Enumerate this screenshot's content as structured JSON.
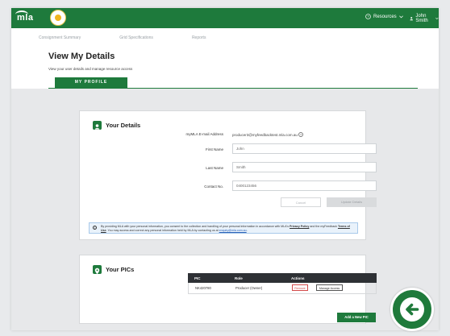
{
  "brand": {
    "logo_text": "mla"
  },
  "header": {
    "resources_label": "Resources",
    "user_label": "John Smith"
  },
  "nav": {
    "tabs": [
      "Consignment Summary",
      "Grid Specifications",
      "Reports"
    ]
  },
  "page": {
    "title": "View My Details",
    "subtitle": "View your user details and manage resource access",
    "profile_tab": "MY PROFILE"
  },
  "details": {
    "section_title": "Your Details",
    "email_label": "myMLA E-mail Address",
    "email_value": "producer3@myfeedbacktest.mla.com.au",
    "first_name_label": "First Name",
    "first_name_value": "John",
    "last_name_label": "Last Name",
    "last_name_value": "Smith",
    "contact_label": "Contact No.",
    "contact_value": "0400123456",
    "cancel_label": "Cancel",
    "update_label": "Update Details"
  },
  "notice": {
    "text_1": "By providing MLA with your personal information, you consent to the collection and handling of your personal information in accordance with MLA's",
    "privacy_link": "Privacy Policy",
    "text_2": "and the",
    "text_3": "myFeedback",
    "terms_link": "Terms of Use",
    "text_4": ". You may access and correct any personal information held by MLA by contacting us at",
    "email_link": "enquiry@mla.com.au",
    "text_5": "."
  },
  "pics": {
    "section_title": "Your PICs",
    "headers": {
      "pic": "PIC",
      "role": "Role",
      "actions": "Actions"
    },
    "rows": [
      {
        "pic": "NK420780",
        "role": "Producer (Owner)",
        "remove": "Remove",
        "manage": "Manage Access"
      }
    ],
    "add_label": "Add a New PIC"
  },
  "colors": {
    "brand_green": "#1e7a3c",
    "remove_red": "#d34a4a"
  },
  "icons": {
    "resources": "help-circle-icon",
    "user": "person-icon",
    "details": "person-icon",
    "pics": "location-pin-icon",
    "notice": "info-icon",
    "back": "arrow-left-icon"
  }
}
